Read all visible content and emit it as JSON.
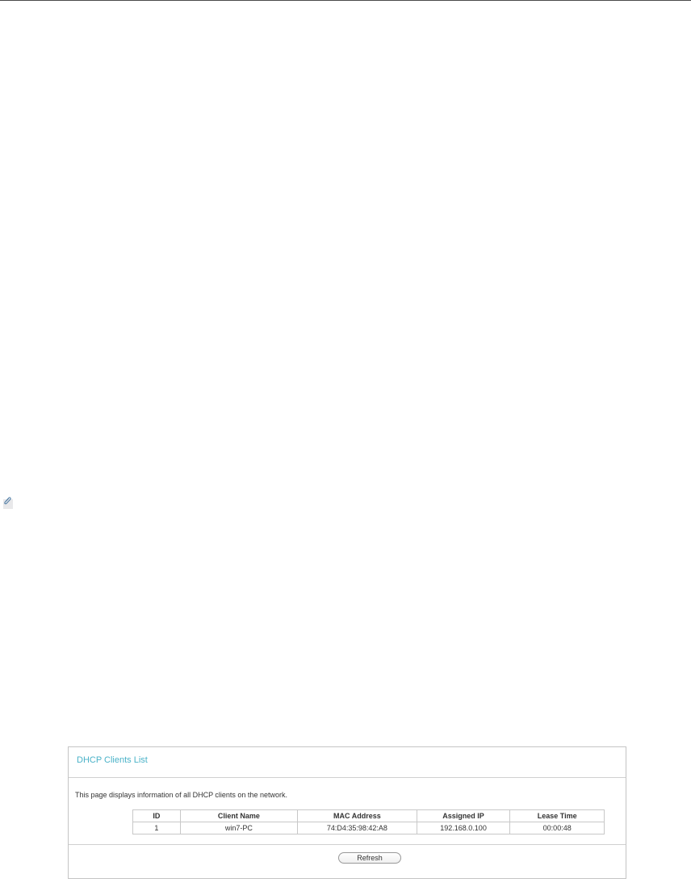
{
  "panel": {
    "title": "DHCP Clients List",
    "description": "This page displays information of all DHCP clients on the network.",
    "refresh_label": "Refresh"
  },
  "table": {
    "headers": [
      "ID",
      "Client Name",
      "MAC Address",
      "Assigned IP",
      "Lease Time"
    ],
    "rows": [
      [
        "1",
        "win7-PC",
        "74:D4:35:98:42:A8",
        "192.168.0.100",
        "00:00:48"
      ]
    ]
  },
  "icons": {
    "attachment": "paperclip-icon"
  },
  "colors": {
    "title_accent": "#4ab2c8",
    "border": "#c4c4c4"
  }
}
